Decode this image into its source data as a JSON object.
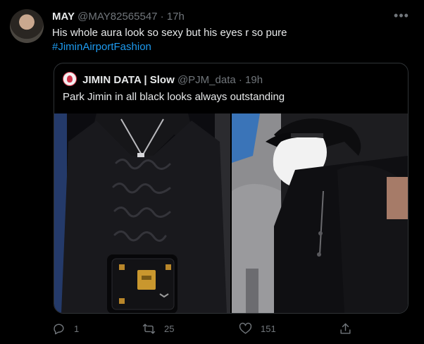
{
  "tweet": {
    "author_name": "MAY",
    "author_handle": "@MAY82565547",
    "separator": "·",
    "time": "17h",
    "more_icon": "more-dots-icon",
    "text_line1": "His whole aura look so sexy but his eyes r so pure",
    "hashtag": "#JiminAirportFashion"
  },
  "quoted": {
    "author_name": "JIMIN DATA | Slow",
    "author_handle": "@PJM_data",
    "separator": "·",
    "time": "19h",
    "text": "Park Jimin in all black looks always outstanding",
    "images": [
      "photo-black-logo-sweater-with-trunk-bag",
      "photo-black-cap-white-mask-airport"
    ]
  },
  "actions": {
    "reply_count": "1",
    "retweet_count": "25",
    "like_count": "151",
    "icons": [
      "reply-icon",
      "retweet-icon",
      "like-icon",
      "share-icon"
    ]
  },
  "colors": {
    "background": "#000000",
    "link": "#1d9bf0",
    "secondary_text": "#71767b",
    "primary_text": "#e7e9ea",
    "border": "#2f3336"
  }
}
